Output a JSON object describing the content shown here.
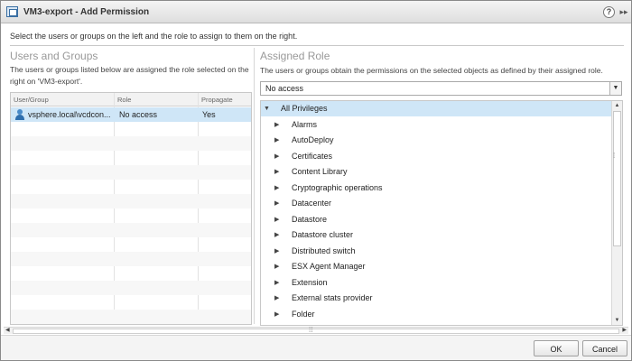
{
  "window": {
    "title": "VM3-export - Add Permission",
    "help_glyph": "?",
    "expand_glyph": "▸▸"
  },
  "instruction": "Select the users or groups on the left and the role to assign to them on the right.",
  "left_panel": {
    "title": "Users and Groups",
    "description": "The users or groups listed below are assigned the role selected on the right on 'VM3-export'.",
    "columns": [
      "User/Group",
      "Role",
      "Propagate"
    ],
    "rows": [
      {
        "user": "vsphere.local\\vcdcon...",
        "role": "No access",
        "propagate": "Yes",
        "selected": true
      }
    ]
  },
  "right_panel": {
    "title": "Assigned Role",
    "description": "The users or groups obtain the permissions on the selected objects as defined by their assigned role.",
    "role_select": {
      "value": "No access"
    },
    "privileges": [
      {
        "label": "All Privileges",
        "expanded": true,
        "level": 0
      },
      {
        "label": "Alarms",
        "level": 1
      },
      {
        "label": "AutoDeploy",
        "level": 1
      },
      {
        "label": "Certificates",
        "level": 1
      },
      {
        "label": "Content Library",
        "level": 1
      },
      {
        "label": "Cryptographic operations",
        "level": 1
      },
      {
        "label": "Datacenter",
        "level": 1
      },
      {
        "label": "Datastore",
        "level": 1
      },
      {
        "label": "Datastore cluster",
        "level": 1
      },
      {
        "label": "Distributed switch",
        "level": 1
      },
      {
        "label": "ESX Agent Manager",
        "level": 1
      },
      {
        "label": "Extension",
        "level": 1
      },
      {
        "label": "External stats provider",
        "level": 1
      },
      {
        "label": "Folder",
        "level": 1
      }
    ]
  },
  "footer": {
    "ok_label": "OK",
    "cancel_label": "Cancel"
  },
  "colors": {
    "selection": "#cfe6f7",
    "section_title": "#999999",
    "border": "#c8c8c8"
  }
}
